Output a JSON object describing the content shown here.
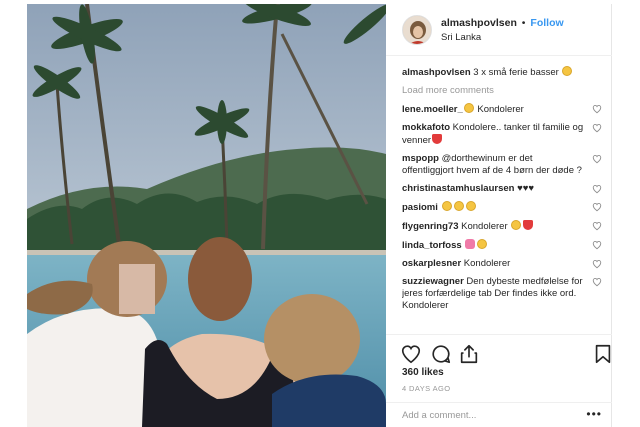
{
  "post": {
    "username": "almashpovlsen",
    "separator": "•",
    "follow_label": "Follow",
    "location": "Sri Lanka",
    "caption_user": "almashpovlsen",
    "caption_text": " 3 x små ferie basser",
    "load_more": "Load more comments",
    "likes": "360 likes",
    "time_ago": "4 DAYS AGO",
    "add_comment_placeholder": "Add a comment...",
    "more_label": "•••"
  },
  "comments": [
    {
      "user": "lene.moeller_",
      "text": " Kondolerer",
      "emoji_before": [
        "yellow"
      ],
      "emoji_after": []
    },
    {
      "user": "mokkafoto",
      "text": " Kondolere.. tanker til familie og venner",
      "emoji_before": [],
      "emoji_after": [
        "red"
      ]
    },
    {
      "user": "mspopp",
      "text": " @dorthewinum er det offentliggjort hvem af de 4 børn der døde ?",
      "emoji_before": [],
      "emoji_after": []
    },
    {
      "user": "christinastamhuslaursen",
      "text": " ♥♥♥",
      "emoji_before": [],
      "emoji_after": []
    },
    {
      "user": "pasiomi",
      "text": " ",
      "emoji_before": [],
      "emoji_after": [
        "yellow",
        "yellow",
        "yellow"
      ]
    },
    {
      "user": "flygenring73",
      "text": " Kondolerer ",
      "emoji_before": [],
      "emoji_after": [
        "yellow",
        "red"
      ]
    },
    {
      "user": "linda_torfoss",
      "text": " ",
      "emoji_before": [],
      "emoji_after": [
        "pink",
        "yellow"
      ]
    },
    {
      "user": "oskarplesner",
      "text": " Kondolerer",
      "emoji_before": [],
      "emoji_after": []
    },
    {
      "user": "suzziewagner",
      "text": " Den dybeste medfølelse for jeres forfærdelige tab  Der findes ikke ord. Kondolerer",
      "emoji_before": [],
      "emoji_after": []
    }
  ],
  "icons": {
    "like": "heart-icon",
    "comment": "comment-bubble-icon",
    "share": "share-arrow-icon",
    "save": "bookmark-icon",
    "comment_like": "small-heart-icon"
  },
  "colors": {
    "follow": "#3897f0",
    "muted": "#999999",
    "text": "#262626"
  }
}
